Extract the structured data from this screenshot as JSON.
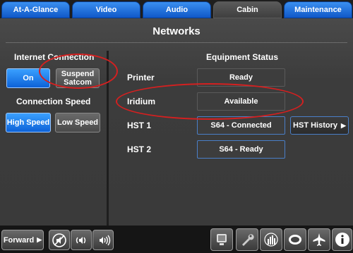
{
  "tabs": [
    {
      "label": "At-A-Glance"
    },
    {
      "label": "Video"
    },
    {
      "label": "Audio"
    },
    {
      "label": "Cabin",
      "active": true
    },
    {
      "label": "Maintenance"
    }
  ],
  "page": {
    "title": "Networks"
  },
  "internet": {
    "heading": "Internet Connection",
    "on_label": "On",
    "suspend_label_line1": "Suspend",
    "suspend_label_line2": "Satcom"
  },
  "speed": {
    "heading": "Connection Speed",
    "high_label": "High Speed",
    "low_label": "Low Speed"
  },
  "equipment": {
    "heading": "Equipment Status",
    "rows": [
      {
        "name": "Printer",
        "status": "Ready"
      },
      {
        "name": "Iridium",
        "status": "Available"
      },
      {
        "name": "HST 1",
        "status": "S64 - Connected"
      },
      {
        "name": "HST 2",
        "status": "S64 - Ready"
      }
    ],
    "hst_history_label": "HST History"
  },
  "bottom": {
    "forward_label": "Forward"
  },
  "colors": {
    "accent": "#1a73e8",
    "annotation": "#d42020"
  }
}
